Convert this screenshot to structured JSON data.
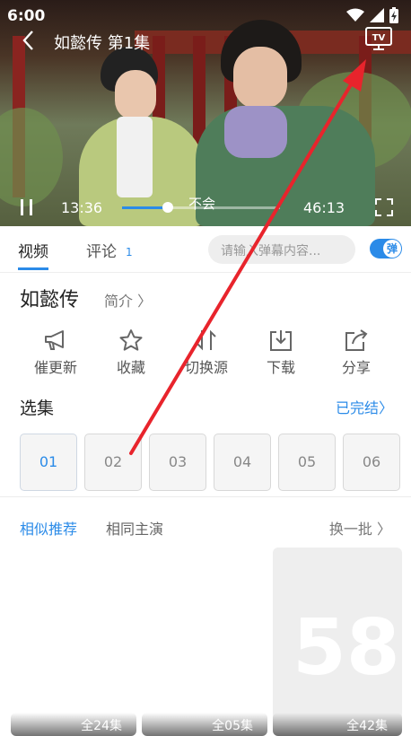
{
  "status_bar": {
    "time": "6:00"
  },
  "player": {
    "title": "如懿传 第1集",
    "current_time": "13:36",
    "total_time": "46:13",
    "subtitle": "不会",
    "progress_fraction": 0.29
  },
  "tabs": {
    "video": "视频",
    "comment": "评论",
    "comment_count": "1",
    "danmaku_placeholder": "请输入弹幕内容...",
    "danmaku_toggle": "弹"
  },
  "info": {
    "title": "如懿传",
    "intro": "简介 〉"
  },
  "actions": [
    {
      "label": "催更新",
      "icon": "megaphone-icon"
    },
    {
      "label": "收藏",
      "icon": "star-icon"
    },
    {
      "label": "切换源",
      "icon": "switch-source-icon"
    },
    {
      "label": "下载",
      "icon": "download-icon"
    },
    {
      "label": "分享",
      "icon": "share-icon"
    }
  ],
  "episodes": {
    "label": "选集",
    "status": "已完结〉",
    "items": [
      "01",
      "02",
      "03",
      "04",
      "05",
      "06"
    ]
  },
  "recommend": {
    "tab_similar": "相似推荐",
    "tab_actors": "相同主演",
    "refresh": "换一批 〉",
    "cards": [
      {
        "label": "全24集"
      },
      {
        "label": "全05集"
      },
      {
        "label": "全42集",
        "placeholder": "58"
      }
    ]
  },
  "colors": {
    "accent": "#2b8be8",
    "annotation_arrow": "#e8242c"
  }
}
